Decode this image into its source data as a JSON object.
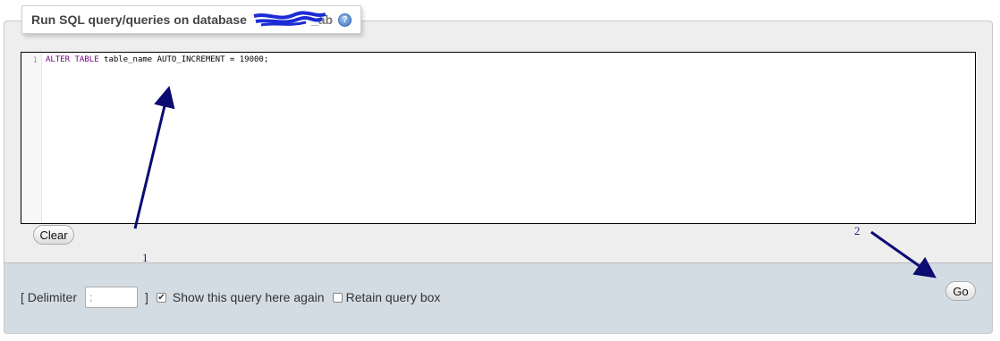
{
  "panel": {
    "title": "Run SQL query/queries on database",
    "title_tail": "_ab",
    "help_icon": "help-icon"
  },
  "editor": {
    "line_number": "1",
    "keyword_1": "ALTER",
    "keyword_2": "TABLE",
    "rest": " table_name AUTO_INCREMENT = 19000;"
  },
  "buttons": {
    "clear": "Clear",
    "go": "Go"
  },
  "options": {
    "delimiter_open": "[ Delimiter",
    "delimiter_value": ";",
    "delimiter_close": "]",
    "show_query_label": "Show this query here again",
    "show_query_checked": true,
    "retain_label": "Retain query box",
    "retain_checked": false
  },
  "annotations": {
    "label_1": "1",
    "label_2": "2",
    "arrow_color": "#0b0b72"
  }
}
